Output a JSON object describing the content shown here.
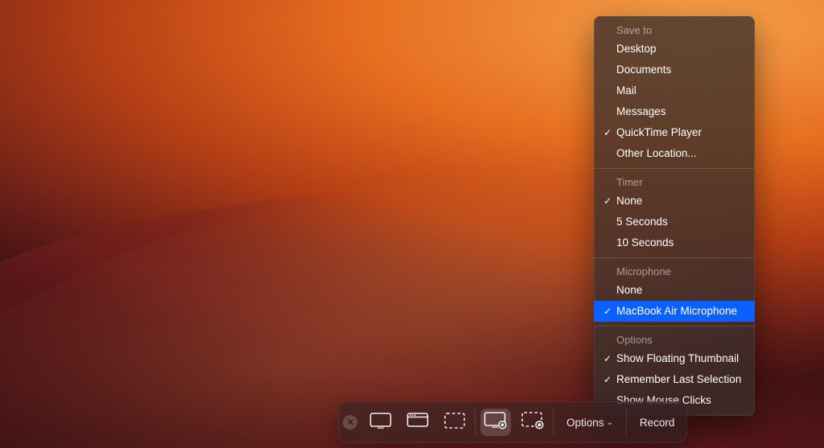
{
  "wallpaper": {
    "name": "macOS Ventura Abstract (orange)"
  },
  "toolbar": {
    "close_tooltip": "Close",
    "capture_icons": [
      {
        "id": "capture-entire-screen",
        "selected": false
      },
      {
        "id": "capture-selected-window",
        "selected": false
      },
      {
        "id": "capture-selected-portion",
        "selected": false
      }
    ],
    "record_icons": [
      {
        "id": "record-entire-screen",
        "selected": true
      },
      {
        "id": "record-selected-portion",
        "selected": false
      }
    ],
    "options_label": "Options",
    "record_label": "Record"
  },
  "options_menu": {
    "save_to": {
      "header": "Save to",
      "items": [
        {
          "label": "Desktop",
          "checked": false
        },
        {
          "label": "Documents",
          "checked": false
        },
        {
          "label": "Mail",
          "checked": false
        },
        {
          "label": "Messages",
          "checked": false
        },
        {
          "label": "QuickTime Player",
          "checked": true
        },
        {
          "label": "Other Location...",
          "checked": false
        }
      ]
    },
    "timer": {
      "header": "Timer",
      "items": [
        {
          "label": "None",
          "checked": true
        },
        {
          "label": "5 Seconds",
          "checked": false
        },
        {
          "label": "10 Seconds",
          "checked": false
        }
      ]
    },
    "microphone": {
      "header": "Microphone",
      "items": [
        {
          "label": "None",
          "checked": false,
          "highlight": false
        },
        {
          "label": "MacBook Air Microphone",
          "checked": true,
          "highlight": true
        }
      ]
    },
    "options": {
      "header": "Options",
      "items": [
        {
          "label": "Show Floating Thumbnail",
          "checked": true
        },
        {
          "label": "Remember Last Selection",
          "checked": true
        },
        {
          "label": "Show Mouse Clicks",
          "checked": false
        }
      ]
    }
  }
}
